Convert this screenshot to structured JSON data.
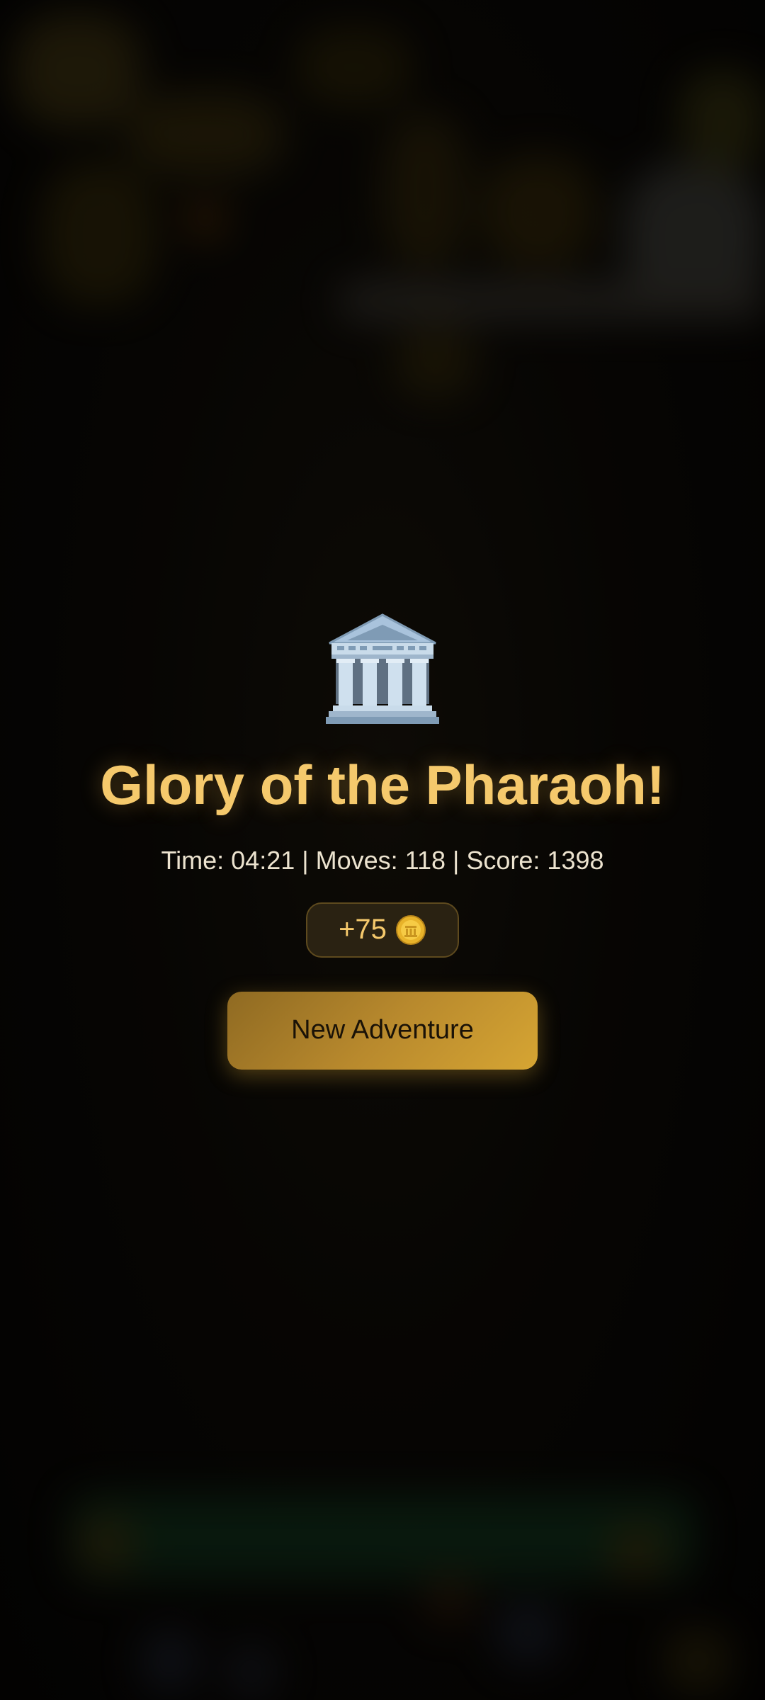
{
  "overlay": {
    "icon": "classical-building-icon",
    "title": "Glory of the Pharaoh!",
    "stats": "Time: 04:21 | Moves: 118 | Score: 1398",
    "reward": {
      "amount": "+75",
      "icon": "coin-icon"
    },
    "button_label": "New Adventure"
  },
  "colors": {
    "title": "#f5c96c",
    "stats": "#ece3cf",
    "button_start": "#8f6a22",
    "button_end": "#d6a533",
    "badge_bg": "#2a2212",
    "badge_border": "#5e4a1e"
  }
}
